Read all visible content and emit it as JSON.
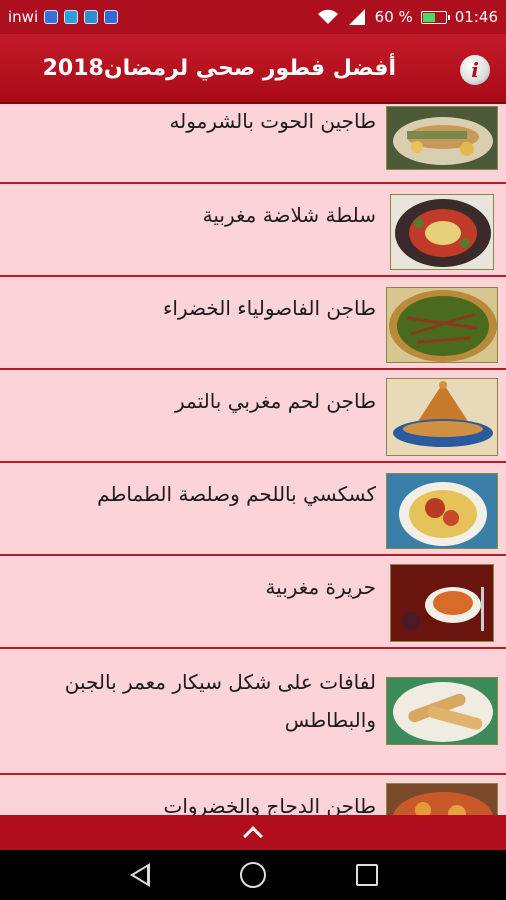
{
  "status_bar": {
    "carrier": "inwi",
    "battery_percent": "60 %",
    "battery_level": 0.6,
    "time": "01:46",
    "icons": [
      "notification-icon",
      "wifi-icon",
      "signal-icon",
      "battery-icon"
    ]
  },
  "app_bar": {
    "title": "أفضل فطور صحي لرمضان2018",
    "info_icon": "info-icon",
    "info_glyph": "i"
  },
  "recipes": [
    {
      "title": "طاجين الحوت بالشرموله"
    },
    {
      "title": "سلطة شلاضة مغربية"
    },
    {
      "title": "طاجن الفاصولياء الخضراء"
    },
    {
      "title": "طاجن لحم مغربي بالتمر"
    },
    {
      "title": "كسكسي باللحم وصلصة الطماطم"
    },
    {
      "title": "حريرة مغربية"
    },
    {
      "title": "لفافات على شكل سيكار معمر بالجبن والبطاطس"
    },
    {
      "title": "طاجن الدجاج والخضروات"
    }
  ],
  "bottom_bar": {
    "icon": "chevron-up-icon"
  },
  "nav_bar": {
    "icons": [
      "back-icon",
      "home-icon",
      "recent-apps-icon"
    ]
  },
  "colors": {
    "primary": "#ae0f1e",
    "list_background": "#fbd3d8",
    "divider": "#b71c2a"
  }
}
